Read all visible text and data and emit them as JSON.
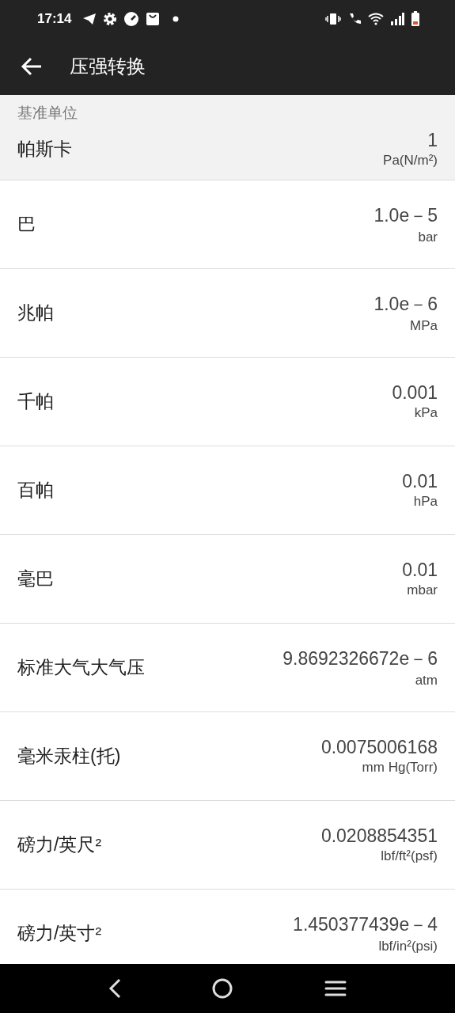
{
  "status_bar": {
    "time": "17:14"
  },
  "app_bar": {
    "title": "压强转换"
  },
  "base_unit": {
    "caption": "基准单位",
    "name": "帕斯卡",
    "value": "1",
    "unit": "Pa(N/m²)"
  },
  "units": [
    {
      "name": "巴",
      "value": "1.0e－5",
      "unit": "bar"
    },
    {
      "name": "兆帕",
      "value": "1.0e－6",
      "unit": "MPa"
    },
    {
      "name": "千帕",
      "value": "0.001",
      "unit": "kPa"
    },
    {
      "name": "百帕",
      "value": "0.01",
      "unit": "hPa"
    },
    {
      "name": "毫巴",
      "value": "0.01",
      "unit": "mbar"
    },
    {
      "name": "标准大气大气压",
      "value": "9.8692326672e－6",
      "unit": "atm"
    },
    {
      "name": "毫米汞柱(托)",
      "value": "0.0075006168",
      "unit": "mm Hg(Torr)"
    },
    {
      "name": "磅力/英尺²",
      "value": "0.0208854351",
      "unit": "lbf/ft²(psf)"
    },
    {
      "name": "磅力/英寸²",
      "value": "1.450377439e－4",
      "unit": "lbf/in²(psi)"
    }
  ]
}
